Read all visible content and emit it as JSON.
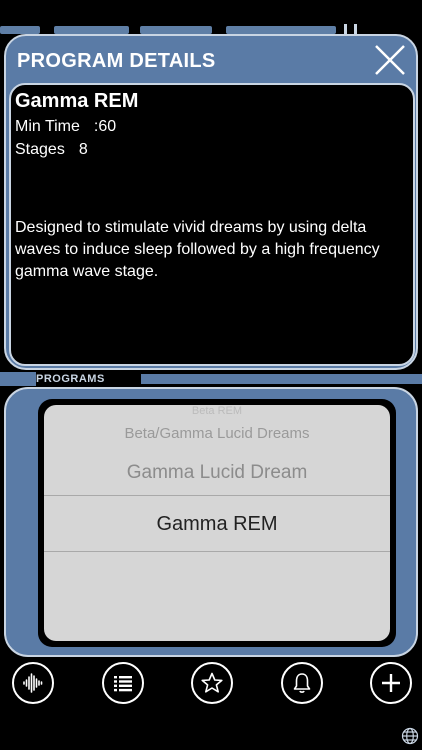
{
  "details": {
    "header_title": "PROGRAM DETAILS",
    "program_name": "Gamma REM",
    "min_time_label": "Min Time",
    "min_time_value": ":60",
    "stages_label": "Stages",
    "stages_value": "8",
    "description": "Designed to stimulate vivid dreams by using delta waves to induce sleep followed by a high frequency gamma wave stage."
  },
  "programs": {
    "section_label": "PROGRAMS",
    "items": [
      "Beta REM",
      "Beta/Gamma Lucid Dreams",
      "Gamma Lucid Dream",
      "Gamma REM"
    ],
    "selected": "Gamma REM"
  },
  "nav": {
    "icons": [
      "waveform-icon",
      "list-icon",
      "star-icon",
      "bell-icon",
      "plus-icon"
    ]
  },
  "colors": {
    "frame_blue": "#5a7ba6",
    "frame_border": "#c9d5e3",
    "picker_bg": "#d6d6d6",
    "background": "#000000"
  }
}
